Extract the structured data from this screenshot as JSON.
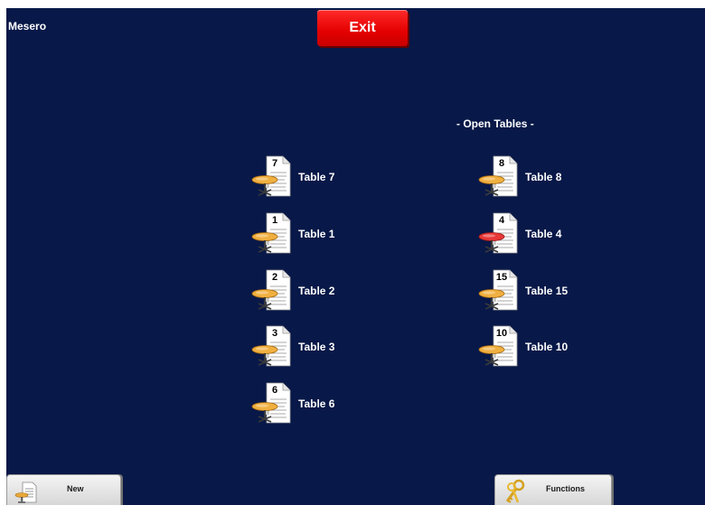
{
  "header": {
    "user_name": "Mesero",
    "exit_label": "Exit"
  },
  "section_title": "- Open Tables -",
  "tables": [
    {
      "number": "7",
      "label": "Table 7",
      "status": "normal"
    },
    {
      "number": "1",
      "label": "Table 1",
      "status": "normal"
    },
    {
      "number": "2",
      "label": "Table 2",
      "status": "normal"
    },
    {
      "number": "3",
      "label": "Table 3",
      "status": "normal"
    },
    {
      "number": "6",
      "label": "Table 6",
      "status": "normal"
    },
    {
      "number": "8",
      "label": "Table 8",
      "status": "normal"
    },
    {
      "number": "4",
      "label": "Table 4",
      "status": "highlighted"
    },
    {
      "number": "15",
      "label": "Table 15",
      "status": "normal"
    },
    {
      "number": "10",
      "label": "Table 10",
      "status": "normal"
    }
  ],
  "footer": {
    "new_label": "New",
    "functions_label": "Functions"
  },
  "colors": {
    "background": "#081848",
    "exit_button": "#e40000",
    "table_top_normal": "#f0b040",
    "table_top_highlighted": "#e83838"
  },
  "icons": {
    "table": "table-with-ticket-icon",
    "new": "new-order-icon",
    "functions": "keys-icon"
  }
}
